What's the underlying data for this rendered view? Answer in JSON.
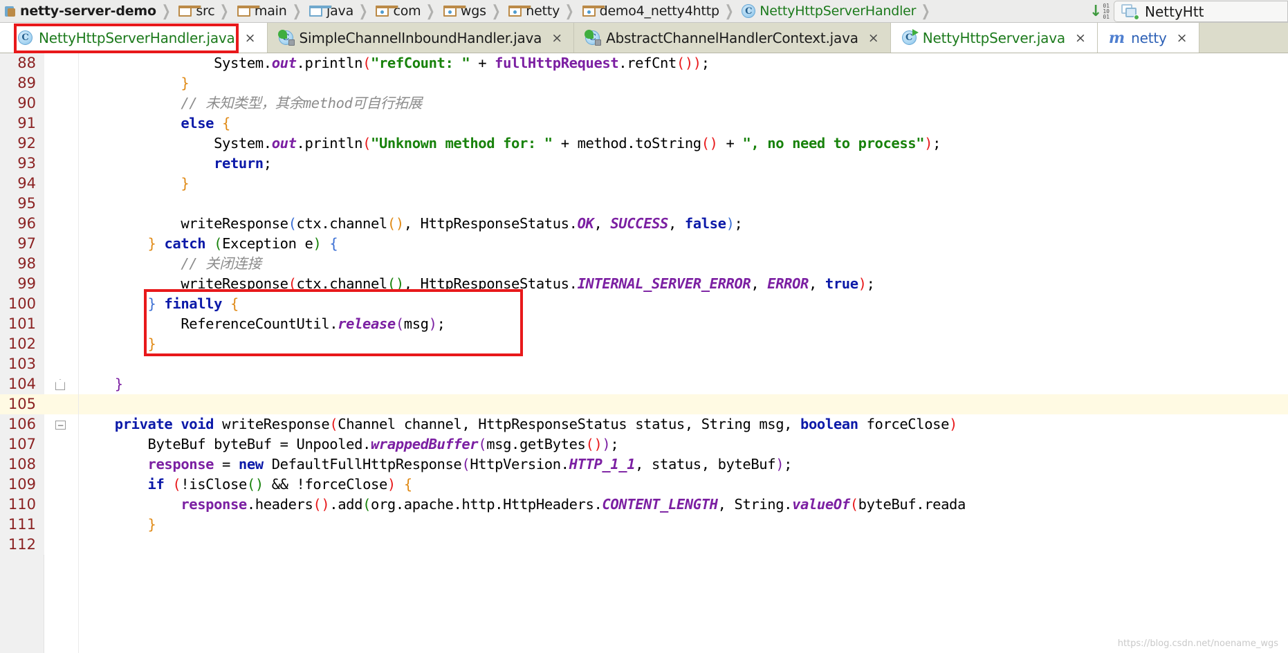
{
  "breadcrumb": {
    "items": [
      {
        "label": "netty-server-demo",
        "icon": "module-icon",
        "kind": "root"
      },
      {
        "label": "src",
        "icon": "folder-icon",
        "kind": "folder-plain"
      },
      {
        "label": "main",
        "icon": "folder-icon",
        "kind": "folder-plain"
      },
      {
        "label": "java",
        "icon": "folder-icon",
        "kind": "folder-blue"
      },
      {
        "label": "com",
        "icon": "package-icon",
        "kind": "package"
      },
      {
        "label": "wgs",
        "icon": "package-icon",
        "kind": "package"
      },
      {
        "label": "netty",
        "icon": "package-icon",
        "kind": "package"
      },
      {
        "label": "demo4_netty4http",
        "icon": "package-icon",
        "kind": "package"
      },
      {
        "label": "NettyHttpServerHandler",
        "icon": "java-class-icon",
        "kind": "class"
      }
    ],
    "separator": "❯"
  },
  "toolbar": {
    "download_icon": "download-arrow-icon",
    "download_bits": [
      "01",
      "10",
      "01"
    ],
    "run_config_label": "NettyHtt",
    "run_config_icon": "run-configuration-icon"
  },
  "tabs": [
    {
      "label": "NettyHttpServerHandler.java",
      "icon": "java-class-icon",
      "close": "×",
      "active": true,
      "color": "green"
    },
    {
      "label": "SimpleChannelInboundHandler.java",
      "icon": "java-class-locked-icon",
      "close": "×",
      "active": false,
      "color": "dark"
    },
    {
      "label": "AbstractChannelHandlerContext.java",
      "icon": "java-class-locked-icon",
      "close": "×",
      "active": false,
      "color": "dark"
    },
    {
      "label": "NettyHttpServer.java",
      "icon": "java-class-runnable-icon",
      "close": "×",
      "active": true,
      "color": "green"
    },
    {
      "label": "netty",
      "icon": "maven-module-icon",
      "close": "×",
      "active": true,
      "color": "blue"
    }
  ],
  "editor": {
    "current_line": 105,
    "first_line": 88,
    "lines": [
      {
        "n": 88,
        "fold": "",
        "current": false
      },
      {
        "n": 89,
        "fold": "",
        "current": false
      },
      {
        "n": 90,
        "fold": "",
        "current": false
      },
      {
        "n": 91,
        "fold": "",
        "current": false
      },
      {
        "n": 92,
        "fold": "",
        "current": false
      },
      {
        "n": 93,
        "fold": "",
        "current": false
      },
      {
        "n": 94,
        "fold": "",
        "current": false
      },
      {
        "n": 95,
        "fold": "",
        "current": false
      },
      {
        "n": 96,
        "fold": "",
        "current": false
      },
      {
        "n": 97,
        "fold": "",
        "current": false
      },
      {
        "n": 98,
        "fold": "",
        "current": false
      },
      {
        "n": 99,
        "fold": "",
        "current": false
      },
      {
        "n": 100,
        "fold": "",
        "current": false
      },
      {
        "n": 101,
        "fold": "",
        "current": false
      },
      {
        "n": 102,
        "fold": "",
        "current": false
      },
      {
        "n": 103,
        "fold": "",
        "current": false
      },
      {
        "n": 104,
        "fold": "arrow",
        "current": false
      },
      {
        "n": 105,
        "fold": "",
        "current": true
      },
      {
        "n": 106,
        "fold": "minus",
        "current": false
      },
      {
        "n": 107,
        "fold": "",
        "current": false
      },
      {
        "n": 108,
        "fold": "",
        "current": false
      },
      {
        "n": 109,
        "fold": "",
        "current": false
      },
      {
        "n": 110,
        "fold": "",
        "current": false
      },
      {
        "n": 111,
        "fold": "",
        "current": false
      },
      {
        "n": 112,
        "fold": "",
        "current": false
      }
    ],
    "code": {
      "l88": "                System.out.println(\"refCount: \" + fullHttpRequest.refCnt());",
      "l89": "            }",
      "l90": "            // 未知类型，其余method可自行拓展",
      "l91": "            else {",
      "l92": "                System.out.println(\"Unknown method for: \" + method.toString() + \", no need to process\");",
      "l93": "                return;",
      "l94": "            }",
      "l95": "",
      "l96": "            writeResponse(ctx.channel(), HttpResponseStatus.OK, SUCCESS, false);",
      "l97": "        } catch (Exception e) {",
      "l98": "            // 关闭连接",
      "l99": "            writeResponse(ctx.channel(), HttpResponseStatus.INTERNAL_SERVER_ERROR, ERROR, true);",
      "l100": "        } finally {",
      "l101": "            ReferenceCountUtil.release(msg);",
      "l102": "        }",
      "l103": "",
      "l104": "    }",
      "l105": "",
      "l106": "    private void writeResponse(Channel channel, HttpResponseStatus status, String msg, boolean forceClose)",
      "l107": "        ByteBuf byteBuf = Unpooled.wrappedBuffer(msg.getBytes());",
      "l108": "        response = new DefaultFullHttpResponse(HttpVersion.HTTP_1_1, status, byteBuf);",
      "l109": "        if (!isClose() && !forceClose) {",
      "l110": "            response.headers().add(org.apache.http.HttpHeaders.CONTENT_LENGTH, String.valueOf(byteBuf.reada",
      "l111": "        }",
      "l112": ""
    }
  },
  "annotations": {
    "tab_highlight_color": "#e8191b",
    "finally_highlight_color": "#e8191b"
  },
  "watermark": "https://blog.csdn.net/noename_wgs",
  "colors": {
    "keyword": "#0b19a8",
    "string": "#18820b",
    "comment": "#8c8c8c",
    "static_field": "#7b1fa2",
    "line_number": "#8b2222",
    "current_line_bg": "#fffae3",
    "tab_bar_bg": "#dcdccb",
    "breadcrumb_bg": "#ececeb",
    "accent_red": "#e8191b",
    "class_green": "#1c7a1c"
  }
}
